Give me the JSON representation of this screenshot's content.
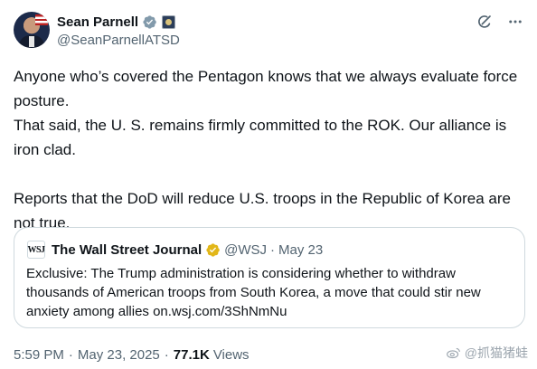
{
  "author": {
    "display_name": "Sean Parnell",
    "handle": "@SeanParnellATSD"
  },
  "tweet": {
    "lines": [
      "Anyone who’s covered the Pentagon knows that we always evaluate force posture.",
      "That said, the U. S. remains firmly committed to the ROK. Our alliance is iron clad.",
      "Reports that the DoD will reduce U.S. troops in the Republic of Korea are not true."
    ]
  },
  "quote": {
    "logo_text": "WSJ",
    "name": "The Wall Street Journal",
    "handle": "@WSJ",
    "separator": "·",
    "date": "May 23",
    "text": "Exclusive: The Trump administration is considering whether to withdraw thousands of American troops from South Korea, a move that could stir new anxiety among allies on.wsj.com/3ShNmNu"
  },
  "meta": {
    "time": "5:59 PM",
    "separator_1": "·",
    "date": "May 23, 2025",
    "separator_2": "·",
    "views_count": "77.1K",
    "views_label": "Views"
  },
  "watermark": {
    "text": "@抓猫猪蛙"
  },
  "colors": {
    "verified_blue": "#1d9bf0",
    "verified_gold": "#e2b719",
    "secondary_text": "#536471",
    "border": "#cfd9de"
  },
  "icons": [
    "verified-badge-icon",
    "government-affiliation-icon",
    "grok-icon",
    "more-options-icon",
    "gold-verified-badge-icon",
    "weibo-icon"
  ]
}
